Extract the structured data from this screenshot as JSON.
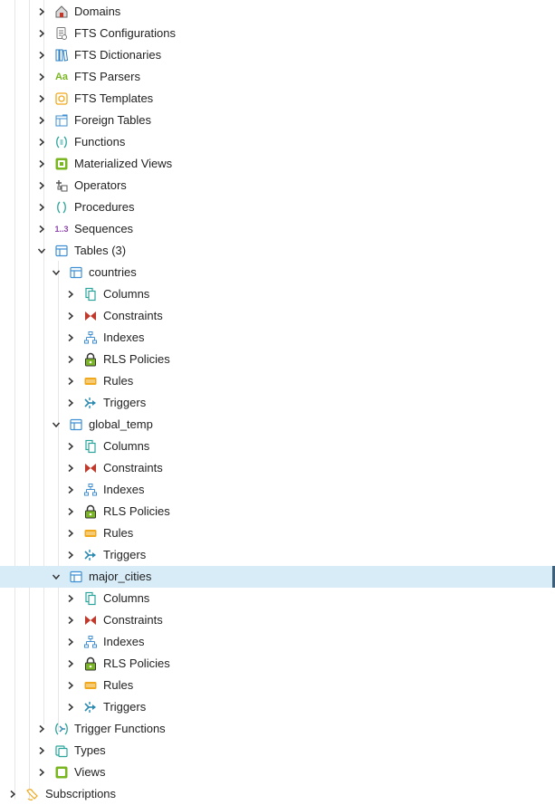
{
  "tree": {
    "schema_items": [
      {
        "label": "Domains",
        "icon": "domains-icon"
      },
      {
        "label": "FTS Configurations",
        "icon": "fts-configurations-icon"
      },
      {
        "label": "FTS Dictionaries",
        "icon": "fts-dictionaries-icon"
      },
      {
        "label": "FTS Parsers",
        "icon": "fts-parsers-icon"
      },
      {
        "label": "FTS Templates",
        "icon": "fts-templates-icon"
      },
      {
        "label": "Foreign Tables",
        "icon": "foreign-tables-icon"
      },
      {
        "label": "Functions",
        "icon": "functions-icon"
      },
      {
        "label": "Materialized Views",
        "icon": "materialized-views-icon"
      },
      {
        "label": "Operators",
        "icon": "operators-icon"
      },
      {
        "label": "Procedures",
        "icon": "procedures-icon"
      },
      {
        "label": "Sequences",
        "icon": "sequences-icon"
      }
    ],
    "tables_node": {
      "label": "Tables (3)",
      "icon": "tables-icon"
    },
    "tables": [
      {
        "name": "countries",
        "children": [
          "Columns",
          "Constraints",
          "Indexes",
          "RLS Policies",
          "Rules",
          "Triggers"
        ]
      },
      {
        "name": "global_temp",
        "children": [
          "Columns",
          "Constraints",
          "Indexes",
          "RLS Policies",
          "Rules",
          "Triggers"
        ]
      },
      {
        "name": "major_cities",
        "selected": true,
        "children": [
          "Columns",
          "Constraints",
          "Indexes",
          "RLS Policies",
          "Rules",
          "Triggers"
        ]
      }
    ],
    "after_tables": [
      {
        "label": "Trigger Functions",
        "icon": "trigger-functions-icon"
      },
      {
        "label": "Types",
        "icon": "types-icon"
      },
      {
        "label": "Views",
        "icon": "views-icon"
      }
    ],
    "subscriptions": {
      "label": "Subscriptions",
      "icon": "subscriptions-icon"
    },
    "sequence_glyph": "1..3",
    "parser_glyph": "Aa"
  },
  "colors": {
    "selected_bg": "#d8ecf8",
    "selected_bar": "#3d5f7a",
    "table_blue": "#3f8fd2",
    "teal": "#2ba59c",
    "green": "#7ab621",
    "orange": "#f0a81c",
    "red": "#c0392b",
    "purple": "#8e44ad"
  }
}
